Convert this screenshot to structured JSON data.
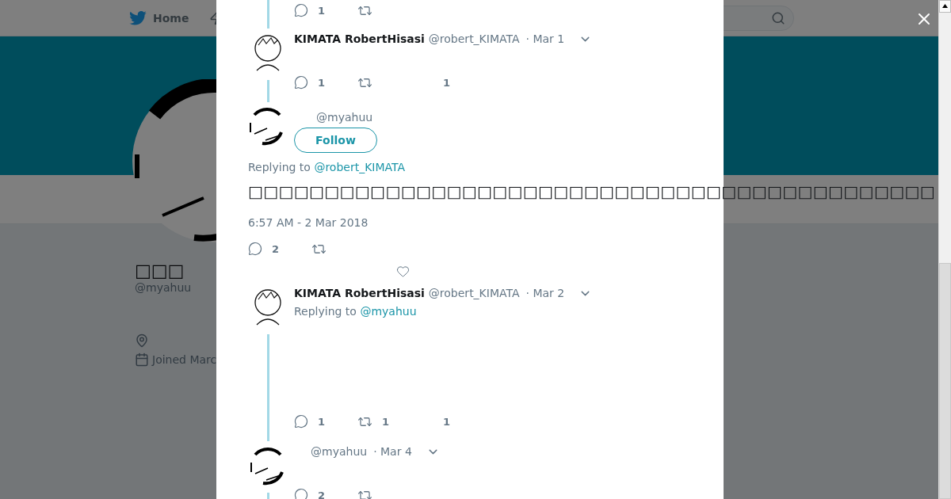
{
  "nav": {
    "home": "Home"
  },
  "profile": {
    "name": "□□□",
    "handle": "@myahuu",
    "joined": "Joined Marc"
  },
  "thread": [
    {
      "kind": "partial",
      "actions": {
        "reply": "1"
      }
    },
    {
      "kind": "reply",
      "avatar": {
        "kind": "sketch"
      },
      "name": "KIMATA RobertHisasi",
      "handle": "@robert_KIMATA",
      "date": "· Mar 1",
      "actions": {
        "reply": "1",
        "like": "1"
      }
    },
    {
      "kind": "focused",
      "avatar": {
        "kind": "ring"
      },
      "handle": "@myahuu",
      "follow": "Follow",
      "replying_label": "Replying to",
      "replying_to": "@robert_KIMATA",
      "text": "□□□□□□□□□□□□□□□□□□□□□□□□□□□□□□□□□□□□□□□□□□□□□",
      "time": "6:57 AM - 2 Mar 2018",
      "actions": {
        "reply": "2"
      }
    },
    {
      "kind": "reply",
      "avatar": {
        "kind": "sketch"
      },
      "name": "KIMATA RobertHisasi",
      "handle": "@robert_KIMATA",
      "date": "· Mar 2",
      "replying_label": "Replying to",
      "replying_to": "@myahuu",
      "actions": {
        "reply": "1",
        "retweet": "1",
        "like": "1"
      }
    },
    {
      "kind": "reply",
      "avatar": {
        "kind": "ring"
      },
      "handle": "@myahuu",
      "date": "· Mar 4",
      "actions": {
        "reply": "2"
      }
    }
  ]
}
